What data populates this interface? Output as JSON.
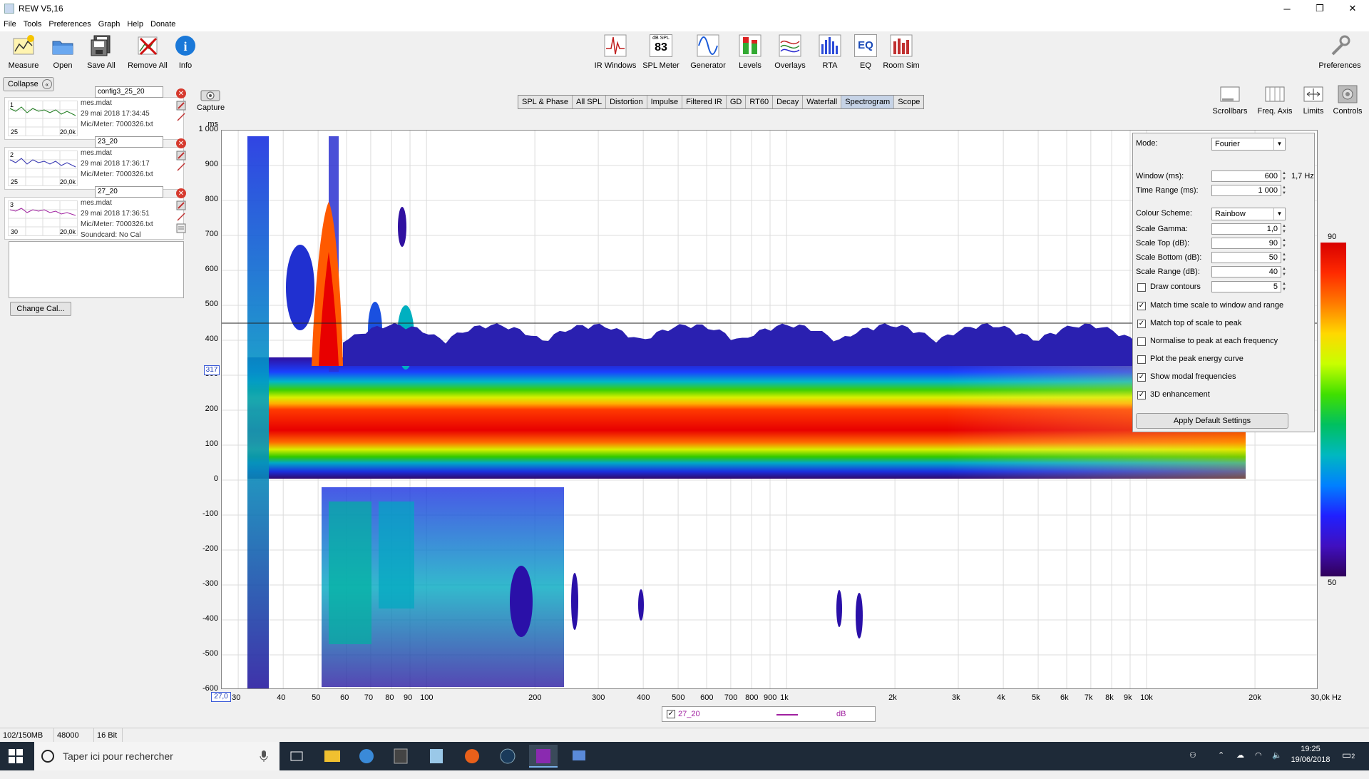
{
  "window": {
    "title": "REW V5,16"
  },
  "menu": [
    "File",
    "Tools",
    "Preferences",
    "Graph",
    "Help",
    "Donate"
  ],
  "toolbar_left": [
    {
      "label": "Measure",
      "icon": "measure-icon"
    },
    {
      "label": "Open",
      "icon": "folder-open-icon"
    },
    {
      "label": "Save All",
      "icon": "save-all-icon"
    },
    {
      "label": "Remove All",
      "icon": "remove-all-icon"
    },
    {
      "label": "Info",
      "icon": "info-icon"
    }
  ],
  "toolbar_center": [
    {
      "label": "IR Windows",
      "icon": "ir-windows-icon"
    },
    {
      "label": "SPL Meter",
      "icon": "spl-meter-icon",
      "top_text": "dB SPL",
      "value": "83"
    },
    {
      "label": "Generator",
      "icon": "generator-icon"
    },
    {
      "label": "Levels",
      "icon": "levels-icon"
    },
    {
      "label": "Overlays",
      "icon": "overlays-icon"
    },
    {
      "label": "RTA",
      "icon": "rta-icon"
    },
    {
      "label": "EQ",
      "icon": "eq-icon",
      "badge": "EQ"
    },
    {
      "label": "Room Sim",
      "icon": "room-sim-icon"
    }
  ],
  "preferences_label": "Preferences",
  "collapse_label": "Collapse",
  "measurements": [
    {
      "name": "config3_25_20",
      "index": "1",
      "file": "mes.mdat",
      "date": "29 mai 2018 17:34:45",
      "cal": "Mic/Meter: 7000326.txt",
      "range_lo": "25",
      "range_hi": "20,0k",
      "color": "#1a7a1a",
      "extra": ""
    },
    {
      "name": "23_20",
      "index": "2",
      "file": "mes.mdat",
      "date": "29 mai 2018 17:36:17",
      "cal": "Mic/Meter: 7000326.txt",
      "range_lo": "25",
      "range_hi": "20,0k",
      "color": "#3030b0",
      "extra": ""
    },
    {
      "name": "27_20",
      "index": "3",
      "file": "mes.mdat",
      "date": "29 mai 2018 17:36:51",
      "cal": "Mic/Meter: 7000326.txt",
      "range_lo": "30",
      "range_hi": "20,0k",
      "color": "#a020a0",
      "extra": "Soundcard: No Cal"
    }
  ],
  "change_cal_label": "Change Cal...",
  "capture_label": "Capture",
  "tabs": [
    "SPL & Phase",
    "All SPL",
    "Distortion",
    "Impulse",
    "Filtered IR",
    "GD",
    "RT60",
    "Decay",
    "Waterfall",
    "Spectrogram",
    "Scope"
  ],
  "active_tab": "Spectrogram",
  "right_tools": [
    {
      "label": "Scrollbars",
      "icon": "scrollbars-icon"
    },
    {
      "label": "Freq. Axis",
      "icon": "freq-axis-icon"
    },
    {
      "label": "Limits",
      "icon": "limits-icon"
    },
    {
      "label": "Controls",
      "icon": "controls-icon"
    }
  ],
  "graph": {
    "y_unit": "ms",
    "y_ticks": [
      "1 000",
      "900",
      "800",
      "700",
      "600",
      "500",
      "400",
      "300",
      "200",
      "100",
      "0",
      "-100",
      "-200",
      "-300",
      "-400",
      "-500",
      "-600"
    ],
    "cursor_y_label": "317",
    "x_ticks": [
      "30",
      "40",
      "50",
      "60",
      "70",
      "80",
      "90",
      "100",
      "200",
      "300",
      "400",
      "500",
      "600",
      "700",
      "800",
      "900",
      "1k",
      "2k",
      "3k",
      "4k",
      "5k",
      "6k",
      "7k",
      "8k",
      "9k",
      "10k",
      "20k",
      "30,0k Hz"
    ],
    "x_start_label": "27,0"
  },
  "controls": {
    "mode_label": "Mode:",
    "mode_value": "Fourier",
    "window_label": "Window (ms):",
    "window_value": "600",
    "window_res": "1,7 Hz",
    "time_range_label": "Time Range (ms):",
    "time_range_value": "1 000",
    "colour_scheme_label": "Colour Scheme:",
    "colour_scheme_value": "Rainbow",
    "scale_gamma_label": "Scale Gamma:",
    "scale_gamma_value": "1,0",
    "scale_top_label": "Scale Top (dB):",
    "scale_top_value": "90",
    "scale_bottom_label": "Scale Bottom (dB):",
    "scale_bottom_value": "50",
    "scale_range_label": "Scale Range (dB):",
    "scale_range_value": "40",
    "draw_contours_label": "Draw contours",
    "draw_contours_value": "5",
    "draw_contours_checked": false,
    "checkboxes": [
      {
        "label": "Match time scale to window and range",
        "checked": true
      },
      {
        "label": "Match top of scale to peak",
        "checked": true
      },
      {
        "label": "Normalise to peak at each frequency",
        "checked": false
      },
      {
        "label": "Plot the peak energy curve",
        "checked": false
      },
      {
        "label": "Show modal frequencies",
        "checked": true
      },
      {
        "label": "3D enhancement",
        "checked": true
      }
    ],
    "apply_default_label": "Apply Default Settings"
  },
  "colour_scale": {
    "top": "90",
    "bottom": "50"
  },
  "legend": {
    "name": "27_20",
    "unit": "dB",
    "color": "#a020a0"
  },
  "status": {
    "memory": "102/150MB",
    "rate": "48000 Hz",
    "bits": "16 Bit"
  },
  "taskbar": {
    "search_placeholder": "Taper ici pour rechercher",
    "time": "19:25",
    "date": "19/06/2018",
    "notif_count": "2"
  }
}
